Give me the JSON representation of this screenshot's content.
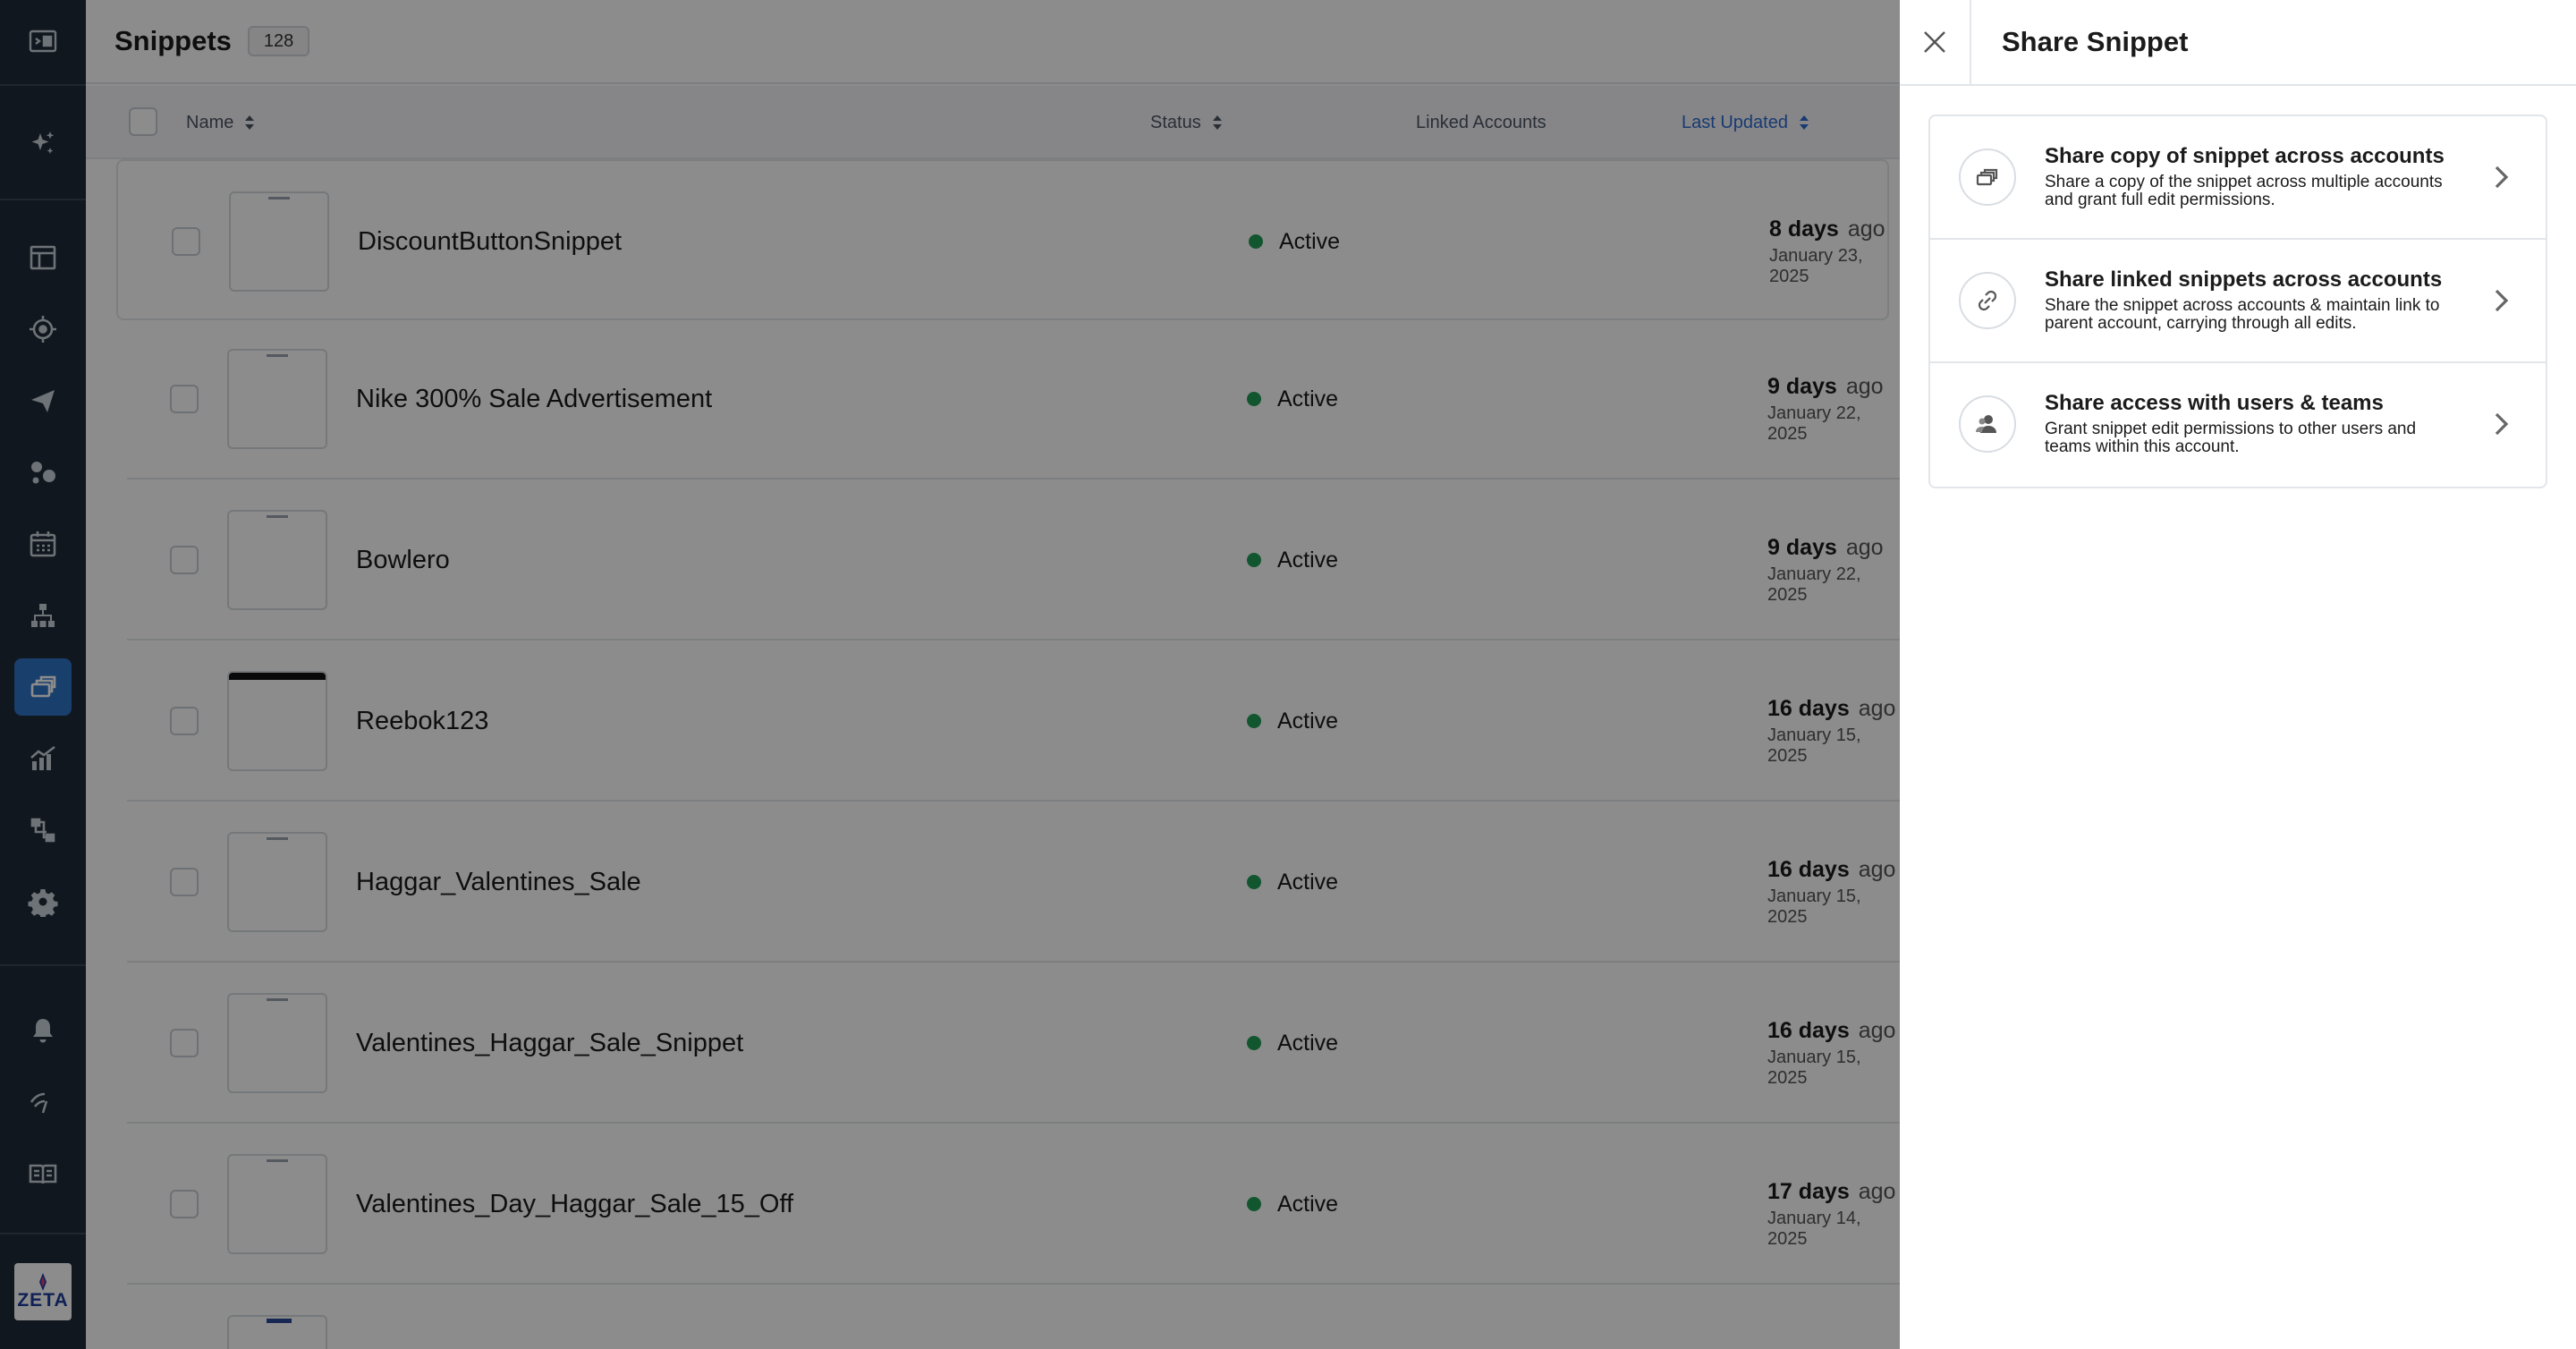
{
  "page": {
    "title": "Snippets",
    "count": "128"
  },
  "table": {
    "columns": {
      "name": "Name",
      "status": "Status",
      "linked": "Linked Accounts",
      "updated": "Last Updated"
    },
    "rows": [
      {
        "name": "DiscountButtonSnippet",
        "status": "Active",
        "days": "8 days",
        "ago": "ago",
        "date": "January 23, 2025"
      },
      {
        "name": "Nike 300% Sale Advertisement",
        "status": "Active",
        "days": "9 days",
        "ago": "ago",
        "date": "January 22, 2025"
      },
      {
        "name": "Bowlero",
        "status": "Active",
        "days": "9 days",
        "ago": "ago",
        "date": "January 22, 2025"
      },
      {
        "name": "Reebok123",
        "status": "Active",
        "days": "16 days",
        "ago": "ago",
        "date": "January 15, 2025"
      },
      {
        "name": "Haggar_Valentines_Sale",
        "status": "Active",
        "days": "16 days",
        "ago": "ago",
        "date": "January 15, 2025"
      },
      {
        "name": "Valentines_Haggar_Sale_Snippet",
        "status": "Active",
        "days": "16 days",
        "ago": "ago",
        "date": "January 15, 2025"
      },
      {
        "name": "Valentines_Day_Haggar_Sale_15_Off",
        "status": "Active",
        "days": "17 days",
        "ago": "ago",
        "date": "January 14, 2025"
      },
      {
        "name": "",
        "status": "",
        "days": "",
        "ago": "",
        "date": ""
      }
    ]
  },
  "drawer": {
    "title": "Share Snippet",
    "options": [
      {
        "title": "Share copy of snippet across accounts",
        "description": "Share a copy of the snippet across multiple accounts and grant full edit permissions.",
        "icon": "copy-stack-icon"
      },
      {
        "title": "Share linked snippets across accounts",
        "description": "Share the snippet across accounts & maintain link to parent account, carrying through all edits.",
        "icon": "link-icon"
      },
      {
        "title": "Share access with users & teams",
        "description": "Grant snippet edit permissions to other users and teams within this account.",
        "icon": "users-icon"
      }
    ]
  },
  "logo": {
    "text": "ZETA"
  },
  "colors": {
    "rail": "#1f2a37",
    "active": "#2f73c7",
    "status_active": "#1f9d55",
    "sorted_column": "#2d6bd0"
  }
}
